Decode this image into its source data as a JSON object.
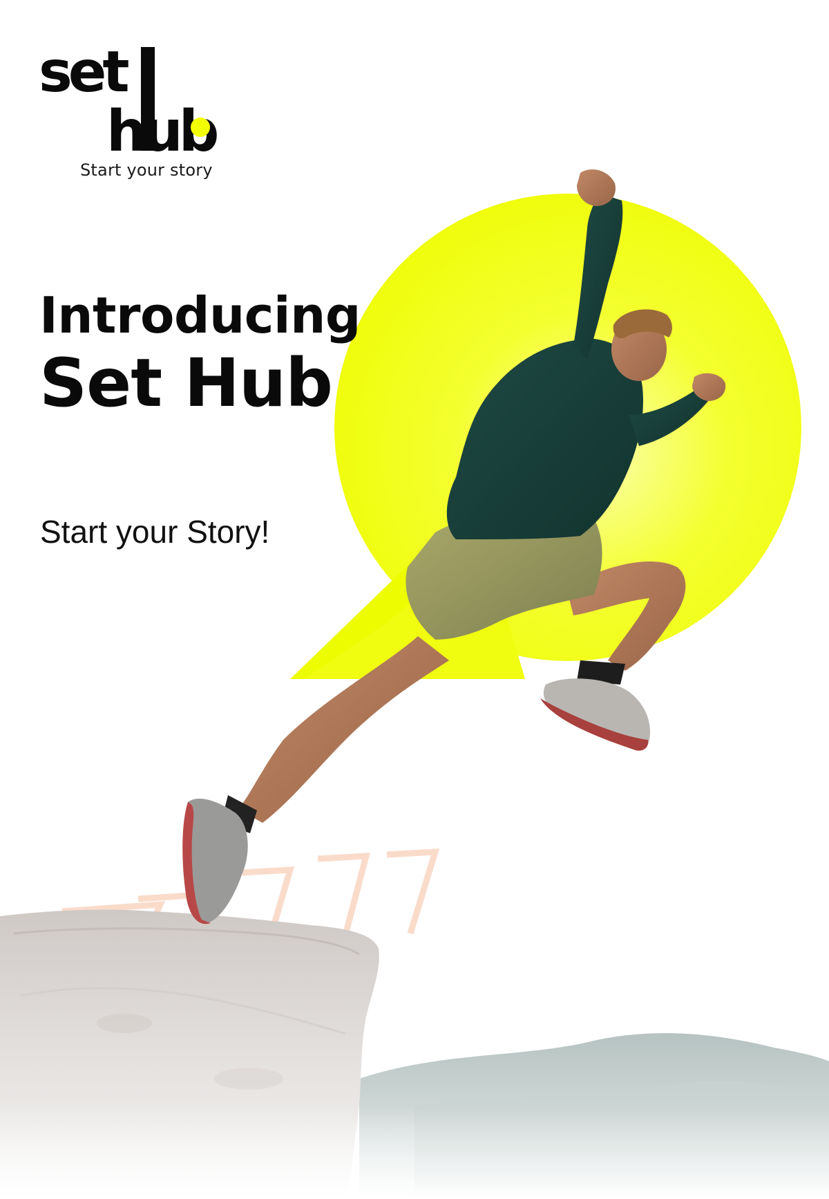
{
  "brand": {
    "logo_text": "set hub",
    "tagline": "Start your story",
    "accent_color": "#F2FF00",
    "ink_color": "#0A0A0A"
  },
  "hero": {
    "title_line1": "Introducing",
    "title_line2": "Set Hub",
    "subtitle": "Start your Story!"
  }
}
